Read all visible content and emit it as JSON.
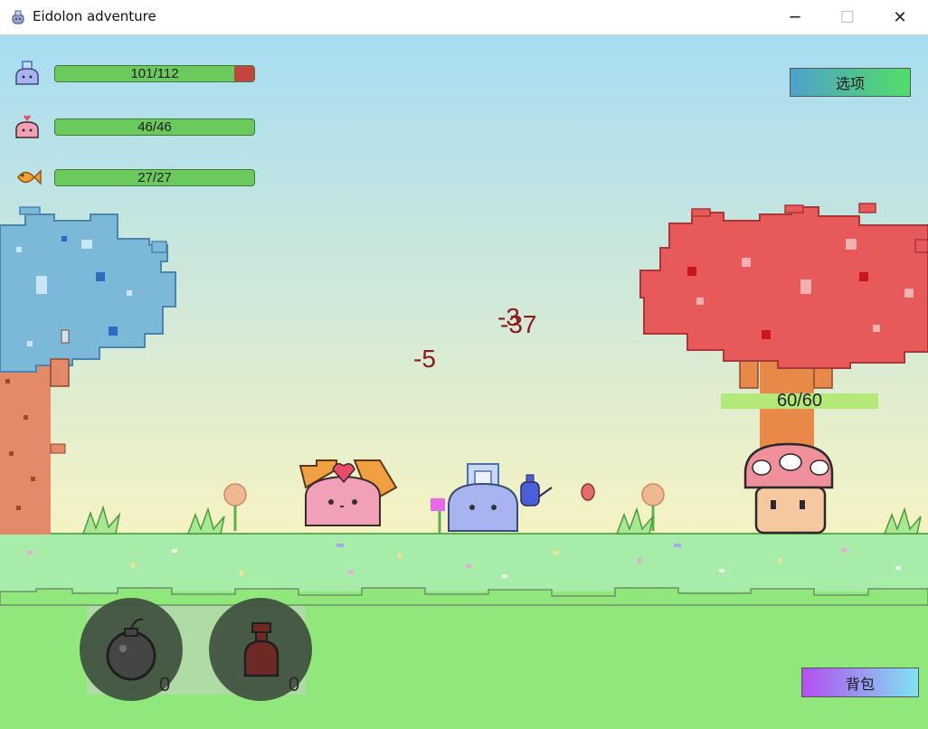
{
  "window": {
    "title": "Eidolon adventure",
    "minimize_glyph": "─",
    "maximize_glyph": "☐",
    "close_glyph": "✕"
  },
  "hud": {
    "rows": [
      {
        "icon": "blue-slime-shield-icon",
        "hp_text": "101/112",
        "hp": 101,
        "max": 112
      },
      {
        "icon": "pink-slime-heart-icon",
        "hp_text": "46/46",
        "hp": 46,
        "max": 46
      },
      {
        "icon": "goldfish-icon",
        "hp_text": "27/27",
        "hp": 27,
        "max": 27
      }
    ]
  },
  "buttons": {
    "options_label": "选项",
    "bag_label": "背包"
  },
  "combat": {
    "damage_numbers": [
      "-5",
      "-3",
      "-37"
    ],
    "enemy_hp_text": "60/60",
    "enemy_name_icon": "mushroom-icon"
  },
  "inventory": {
    "items": [
      {
        "icon": "bomb-icon",
        "count": "0"
      },
      {
        "icon": "potion-icon",
        "count": "0"
      }
    ]
  },
  "colors": {
    "hp_fill": "#6acb5c",
    "hp_missing": "#c2453e",
    "damage_text": "#8b1a1a",
    "sky_top": "#a6ddf2",
    "sky_bottom": "#f6f3c2",
    "grass": "#90e87a"
  }
}
